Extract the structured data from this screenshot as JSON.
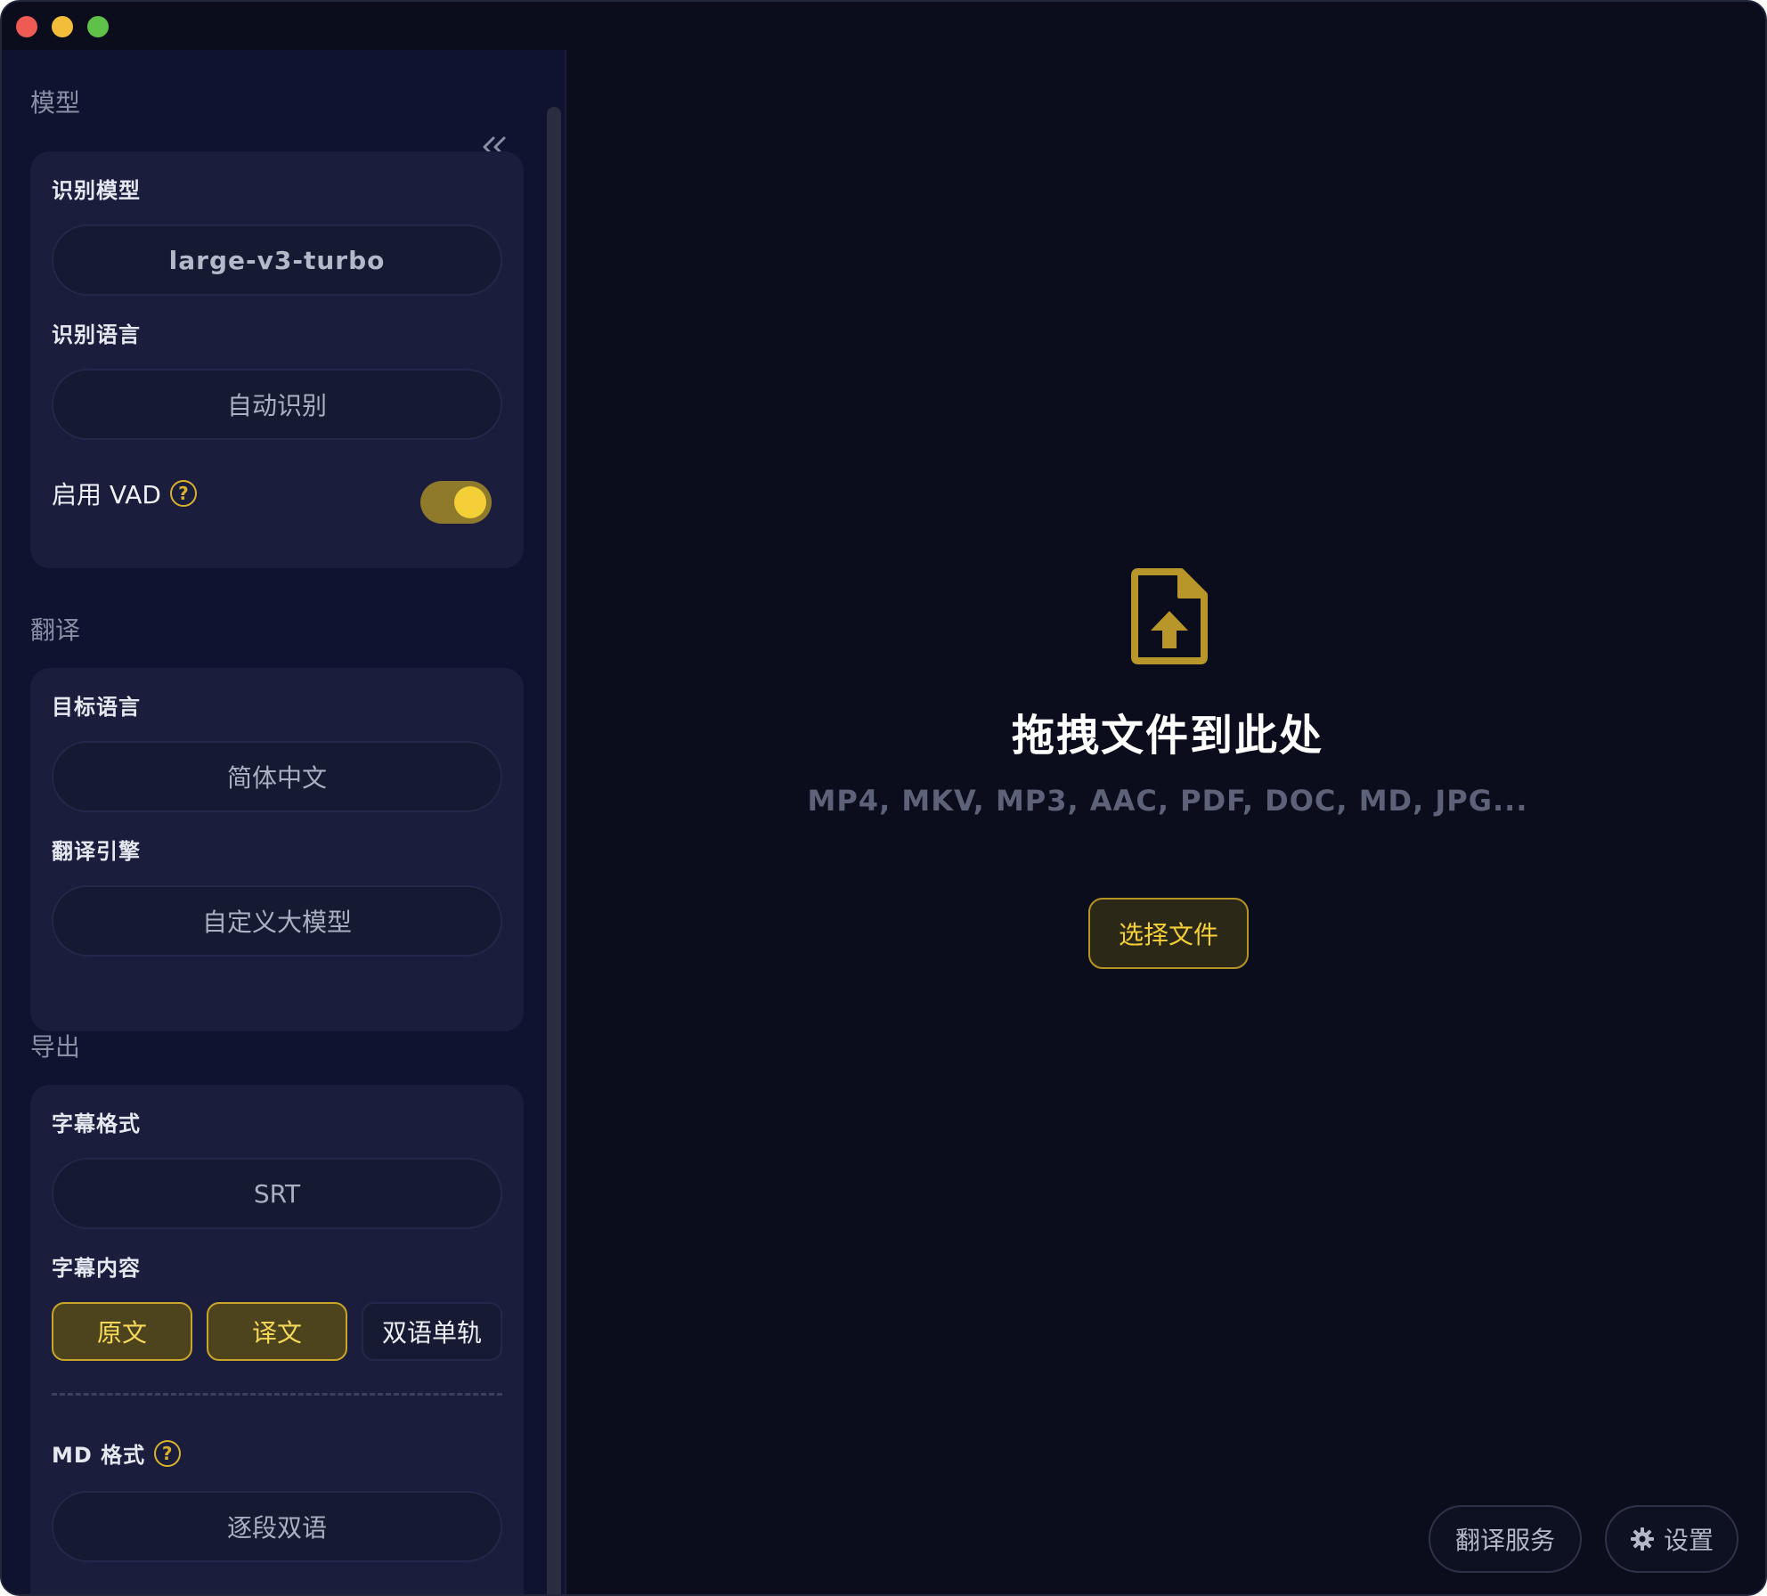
{
  "sidebar": {
    "model_section": "模型",
    "model_card": {
      "recognition_model_label": "识别模型",
      "recognition_model_value": "large-v3-turbo",
      "recognition_language_label": "识别语言",
      "recognition_language_value": "自动识别",
      "vad_label": "启用 VAD",
      "vad_enabled": true
    },
    "translation_section": "翻译",
    "translation_card": {
      "target_language_label": "目标语言",
      "target_language_value": "简体中文",
      "engine_label": "翻译引擎",
      "engine_value": "自定义大模型"
    },
    "export_section": "导出",
    "export_card": {
      "subtitle_format_label": "字幕格式",
      "subtitle_format_value": "SRT",
      "subtitle_content_label": "字幕内容",
      "content_options": [
        {
          "label": "原文",
          "selected": true
        },
        {
          "label": "译文",
          "selected": true
        },
        {
          "label": "双语单轨",
          "selected": false
        }
      ],
      "md_format_label": "MD 格式",
      "md_format_value": "逐段双语"
    }
  },
  "main": {
    "drop_title": "拖拽文件到此处",
    "supported_formats": "MP4, MKV, MP3, AAC, PDF, DOC, MD, JPG...",
    "choose_file_button": "选择文件",
    "translation_service_button": "翻译服务",
    "settings_button": "设置"
  },
  "colors": {
    "accent": "#f5cf38",
    "background": "#0b0d1c",
    "sidebar": "#0f1330",
    "card": "#1a1e3c"
  },
  "icons": {
    "collapse": "double-chevron-left-icon",
    "help": "question-circle-icon",
    "upload": "file-upload-icon",
    "settings": "gear-icon"
  }
}
